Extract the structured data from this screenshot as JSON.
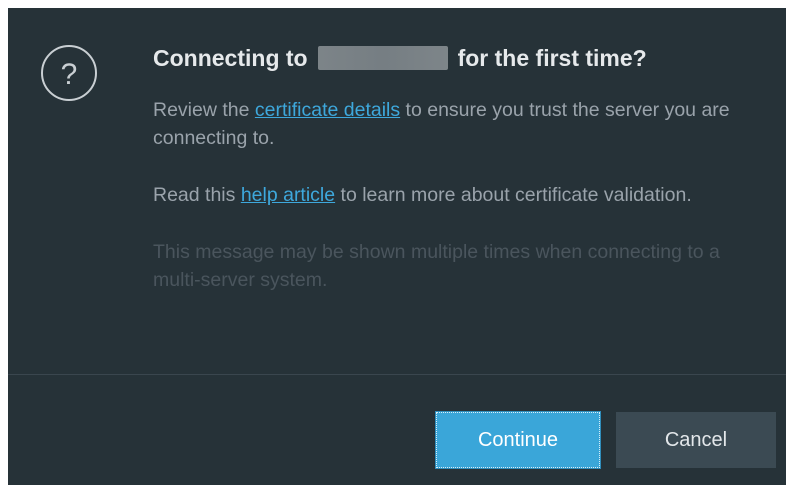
{
  "dialog": {
    "title_prefix": "Connecting to",
    "title_suffix": "for the first time?",
    "icon": "question-circle-icon",
    "para1": {
      "before": "Review the ",
      "link": "certificate details",
      "after": " to ensure you trust the server you are connecting to."
    },
    "para2": {
      "before": "Read this ",
      "link": "help article",
      "after": " to learn more about certificate validation."
    },
    "para3": "This message may be shown multiple times when connecting to a multi-server system.",
    "buttons": {
      "continue": "Continue",
      "cancel": "Cancel"
    }
  },
  "colors": {
    "background": "#263238",
    "accent": "#3aa6d9",
    "link": "#3ea8dc",
    "secondary_button": "#3b4a53"
  }
}
